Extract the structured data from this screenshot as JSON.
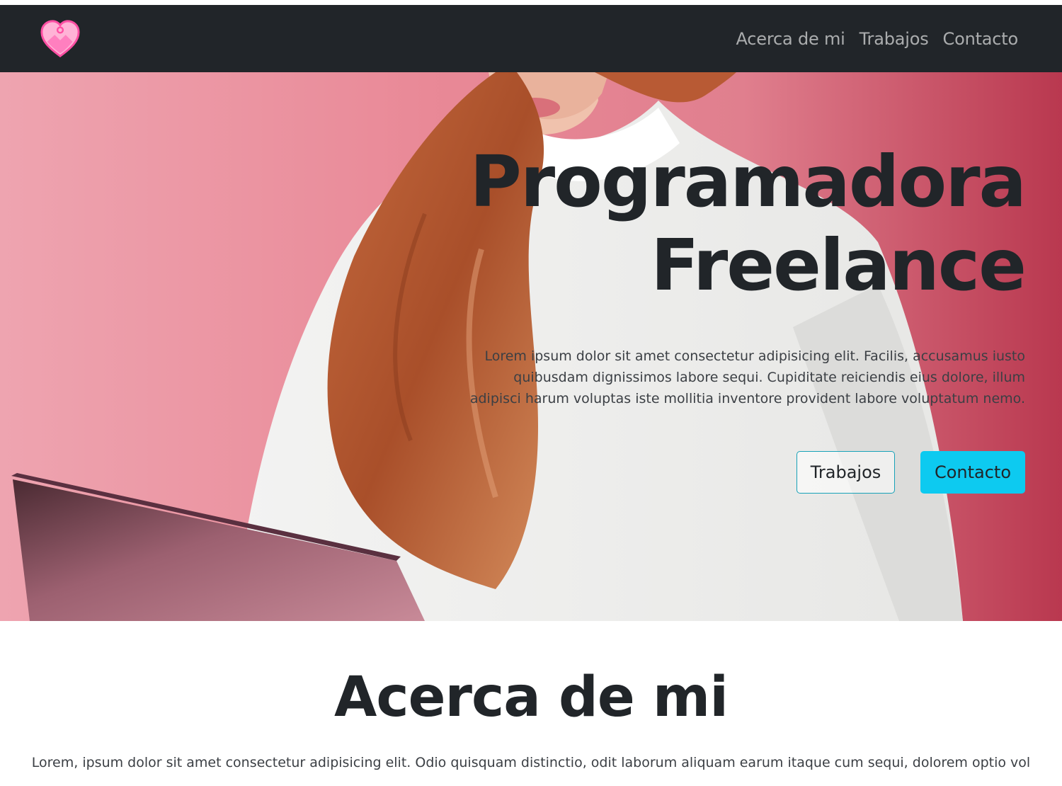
{
  "navbar": {
    "logo_icon": "heart-image-logo-icon",
    "links": [
      "Acerca de mi",
      "Trabajos",
      "Contacto"
    ]
  },
  "hero": {
    "title_line1": "Programadora",
    "title_line2": "Freelance",
    "text": "Lorem ipsum dolor sit amet consectetur adipisicing elit. Facilis, accusamus iusto quibusdam dignissimos labore sequi. Cupiditate reiciendis eius dolore, illum adipisci harum voluptas iste mollitia inventore provident labore voluptatum nemo.",
    "button_secondary": "Trabajos",
    "button_primary": "Contacto"
  },
  "about": {
    "title": "Acerca de mi",
    "text": "Lorem, ipsum dolor sit amet consectetur adipisicing elit. Odio quisquam distinctio, odit laborum aliquam earum itaque cum sequi, dolorem optio vol"
  },
  "colors": {
    "navbar_bg": "#212529",
    "accent": "#0dcaf0",
    "logo_pink": "#ff4fa3"
  }
}
